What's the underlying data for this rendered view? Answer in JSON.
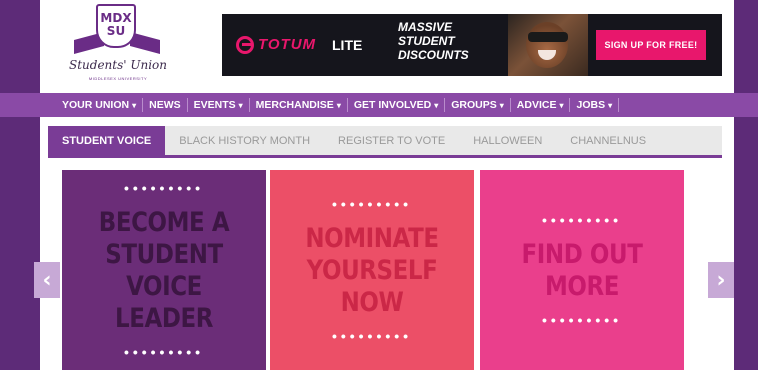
{
  "logo": {
    "shield_text": "MDX SU",
    "script_text": "Students' Union",
    "sub_text": "MIDDLESEX UNIVERSITY"
  },
  "banner": {
    "brand": "TOTUM",
    "brand_suffix": "LITE",
    "headline": "MASSIVE STUDENT DISCOUNTS",
    "cta": "SIGN UP FOR FREE!"
  },
  "nav": {
    "items": [
      {
        "label": "YOUR UNION",
        "dropdown": true
      },
      {
        "label": "NEWS",
        "dropdown": false
      },
      {
        "label": "EVENTS",
        "dropdown": true
      },
      {
        "label": "MERCHANDISE",
        "dropdown": true
      },
      {
        "label": "GET INVOLVED",
        "dropdown": true
      },
      {
        "label": "GROUPS",
        "dropdown": true
      },
      {
        "label": "ADVICE",
        "dropdown": true
      },
      {
        "label": "JOBS",
        "dropdown": true
      }
    ]
  },
  "tabs": [
    {
      "label": "STUDENT VOICE",
      "active": true
    },
    {
      "label": "BLACK HISTORY MONTH",
      "active": false
    },
    {
      "label": "REGISTER TO VOTE",
      "active": false
    },
    {
      "label": "HALLOWEEN",
      "active": false
    },
    {
      "label": "CHANNELNUS",
      "active": false
    }
  ],
  "slides": [
    {
      "text": "BECOME A STUDENT VOICE LEADER",
      "dots": "•••••••••"
    },
    {
      "text": "NOMINATE YOURSELF NOW",
      "dots": "•••••••••"
    },
    {
      "text": "FIND OUT MORE",
      "dots": "•••••••••"
    }
  ],
  "carousel": {
    "prev_icon": "chevron-left-icon",
    "next_icon": "chevron-right-icon",
    "prev_glyph": "‹",
    "next_glyph": "›"
  },
  "colors": {
    "brand_purple": "#7a3c96",
    "nav_purple": "#8a4aa6",
    "frame_purple": "#5d2b78",
    "totum_pink": "#e8176c"
  }
}
